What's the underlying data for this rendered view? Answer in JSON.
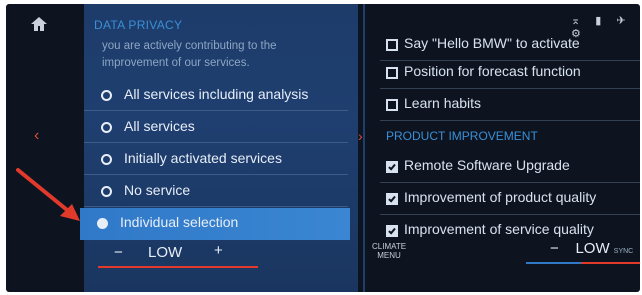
{
  "left": {
    "section_title": "DATA PRIVACY",
    "intro_line1": "you are actively contributing to the",
    "intro_line2": "improvement of our services.",
    "options": [
      {
        "label": "All services including analysis",
        "selected": false
      },
      {
        "label": "All services",
        "selected": false
      },
      {
        "label": "Initially activated services",
        "selected": false
      },
      {
        "label": "No service",
        "selected": false
      },
      {
        "label": "Individual selection",
        "selected": true
      }
    ],
    "temp_minus": "−",
    "temp_value": "LOW",
    "temp_plus": "+"
  },
  "right": {
    "top_items": [
      {
        "label": "Say \"Hello BMW\" to activate",
        "checked": false
      },
      {
        "label": "Position for forecast function",
        "checked": false
      },
      {
        "label": "Learn habits",
        "checked": false
      }
    ],
    "section_title": "PRODUCT IMPROVEMENT",
    "checked_items": [
      {
        "label": "Remote Software Upgrade",
        "checked": true
      },
      {
        "label": "Improvement of product quality",
        "checked": true
      },
      {
        "label": "Improvement of service quality",
        "checked": true
      }
    ],
    "climate_menu_line1": "CLIMATE",
    "climate_menu_line2": "MENU",
    "temp_minus": "−",
    "temp_value": "LOW",
    "sync_label": "SYNC"
  },
  "colors": {
    "accent_blue": "#3a8fd6",
    "selection_blue": "#2f79c8",
    "warning_red": "#e23a2a"
  },
  "icons": [
    "home-icon",
    "chevron-left-icon",
    "chevron-right-icon",
    "status-icons",
    "annotation-arrow"
  ]
}
